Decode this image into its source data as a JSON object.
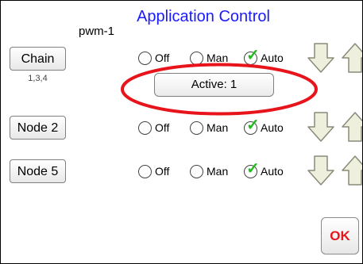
{
  "header": {
    "title": "Application Control",
    "subtitle": "pwm-1"
  },
  "rows": [
    {
      "node_label": "Chain",
      "node_sub": "1,3,4",
      "modes": {
        "off": "Off",
        "manual": "Man",
        "auto": "Auto"
      },
      "selected_mode": "Auto"
    },
    {
      "node_label": "Node 2",
      "modes": {
        "off": "Off",
        "manual": "Man",
        "auto": "Auto"
      },
      "selected_mode": "Auto"
    },
    {
      "node_label": "Node 5",
      "modes": {
        "off": "Off",
        "manual": "Man",
        "auto": "Auto"
      },
      "selected_mode": "Auto"
    }
  ],
  "active_field": {
    "label": "Active: 1"
  },
  "annotation": {
    "color": "#e8141c"
  },
  "footer": {
    "ok_label": "OK"
  },
  "colors": {
    "title": "#1a1aff",
    "check": "#22bb22",
    "ok_text": "#e8141c",
    "arrow_fill": "#efefdd"
  },
  "icons": {
    "down_arrow": "down-arrow-icon",
    "up_arrow": "up-arrow-icon",
    "checkmark": "checkmark-icon"
  }
}
